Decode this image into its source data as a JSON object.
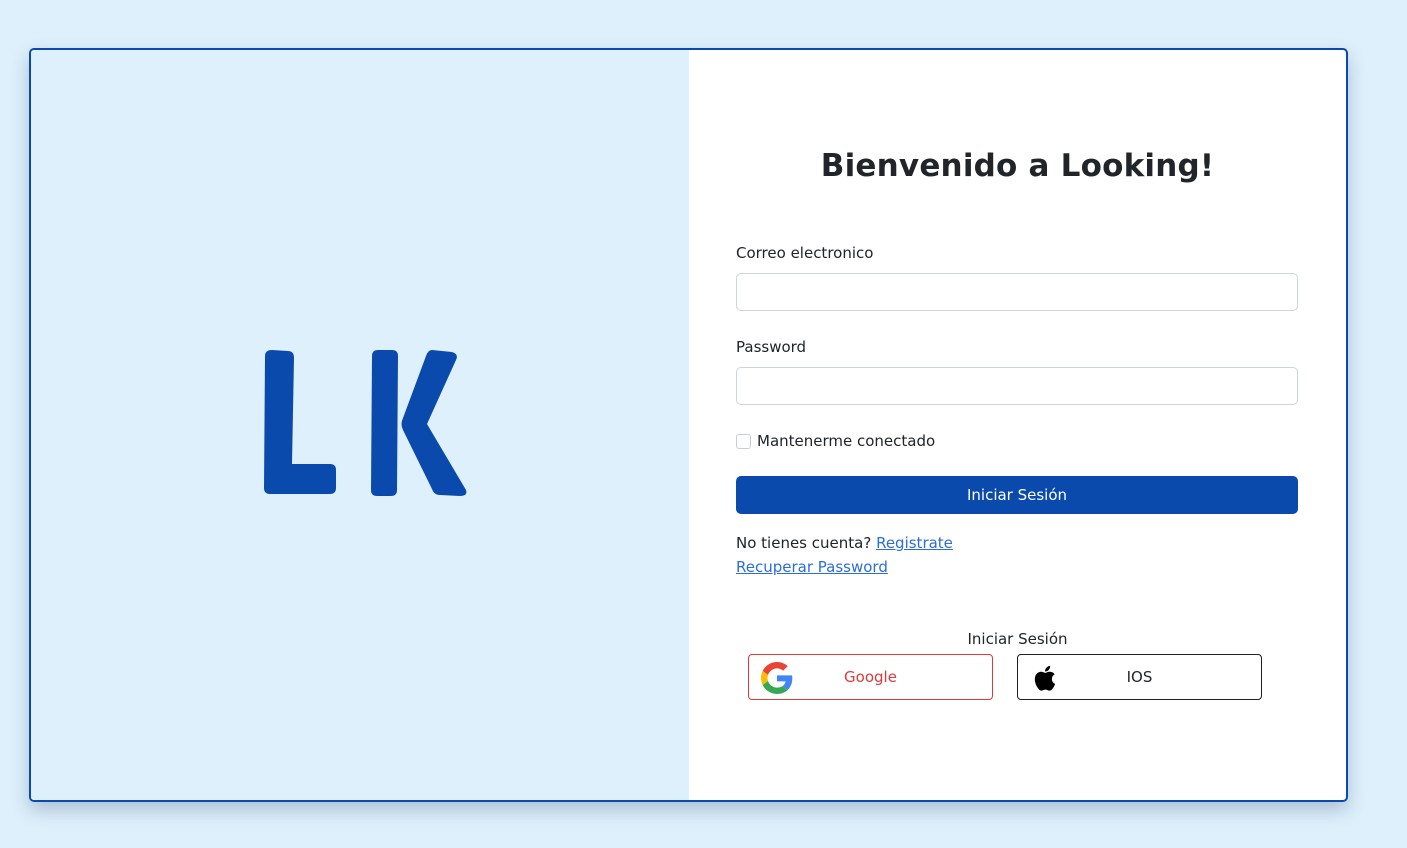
{
  "brand": {
    "logo_text": "LK",
    "color": "#0b4aad"
  },
  "login": {
    "title": "Bienvenido a Looking!",
    "email_label": "Correo electronico",
    "email_value": "",
    "password_label": "Password",
    "password_value": "",
    "remember_label": "Mantenerme conectado",
    "remember_checked": false,
    "submit_label": "Iniciar Sesión",
    "no_account_text": "No tienes cuenta?",
    "register_link": "Registrate",
    "recover_link": "Recuperar Password"
  },
  "social": {
    "title": "Iniciar Sesión",
    "google_label": "Google",
    "google_icon": "google-icon",
    "ios_label": "IOS",
    "ios_icon": "apple-icon"
  },
  "colors": {
    "background": "#def0fb",
    "primary": "#0b4aad",
    "link": "#2a6ed8",
    "google_red": "#e0393b"
  }
}
